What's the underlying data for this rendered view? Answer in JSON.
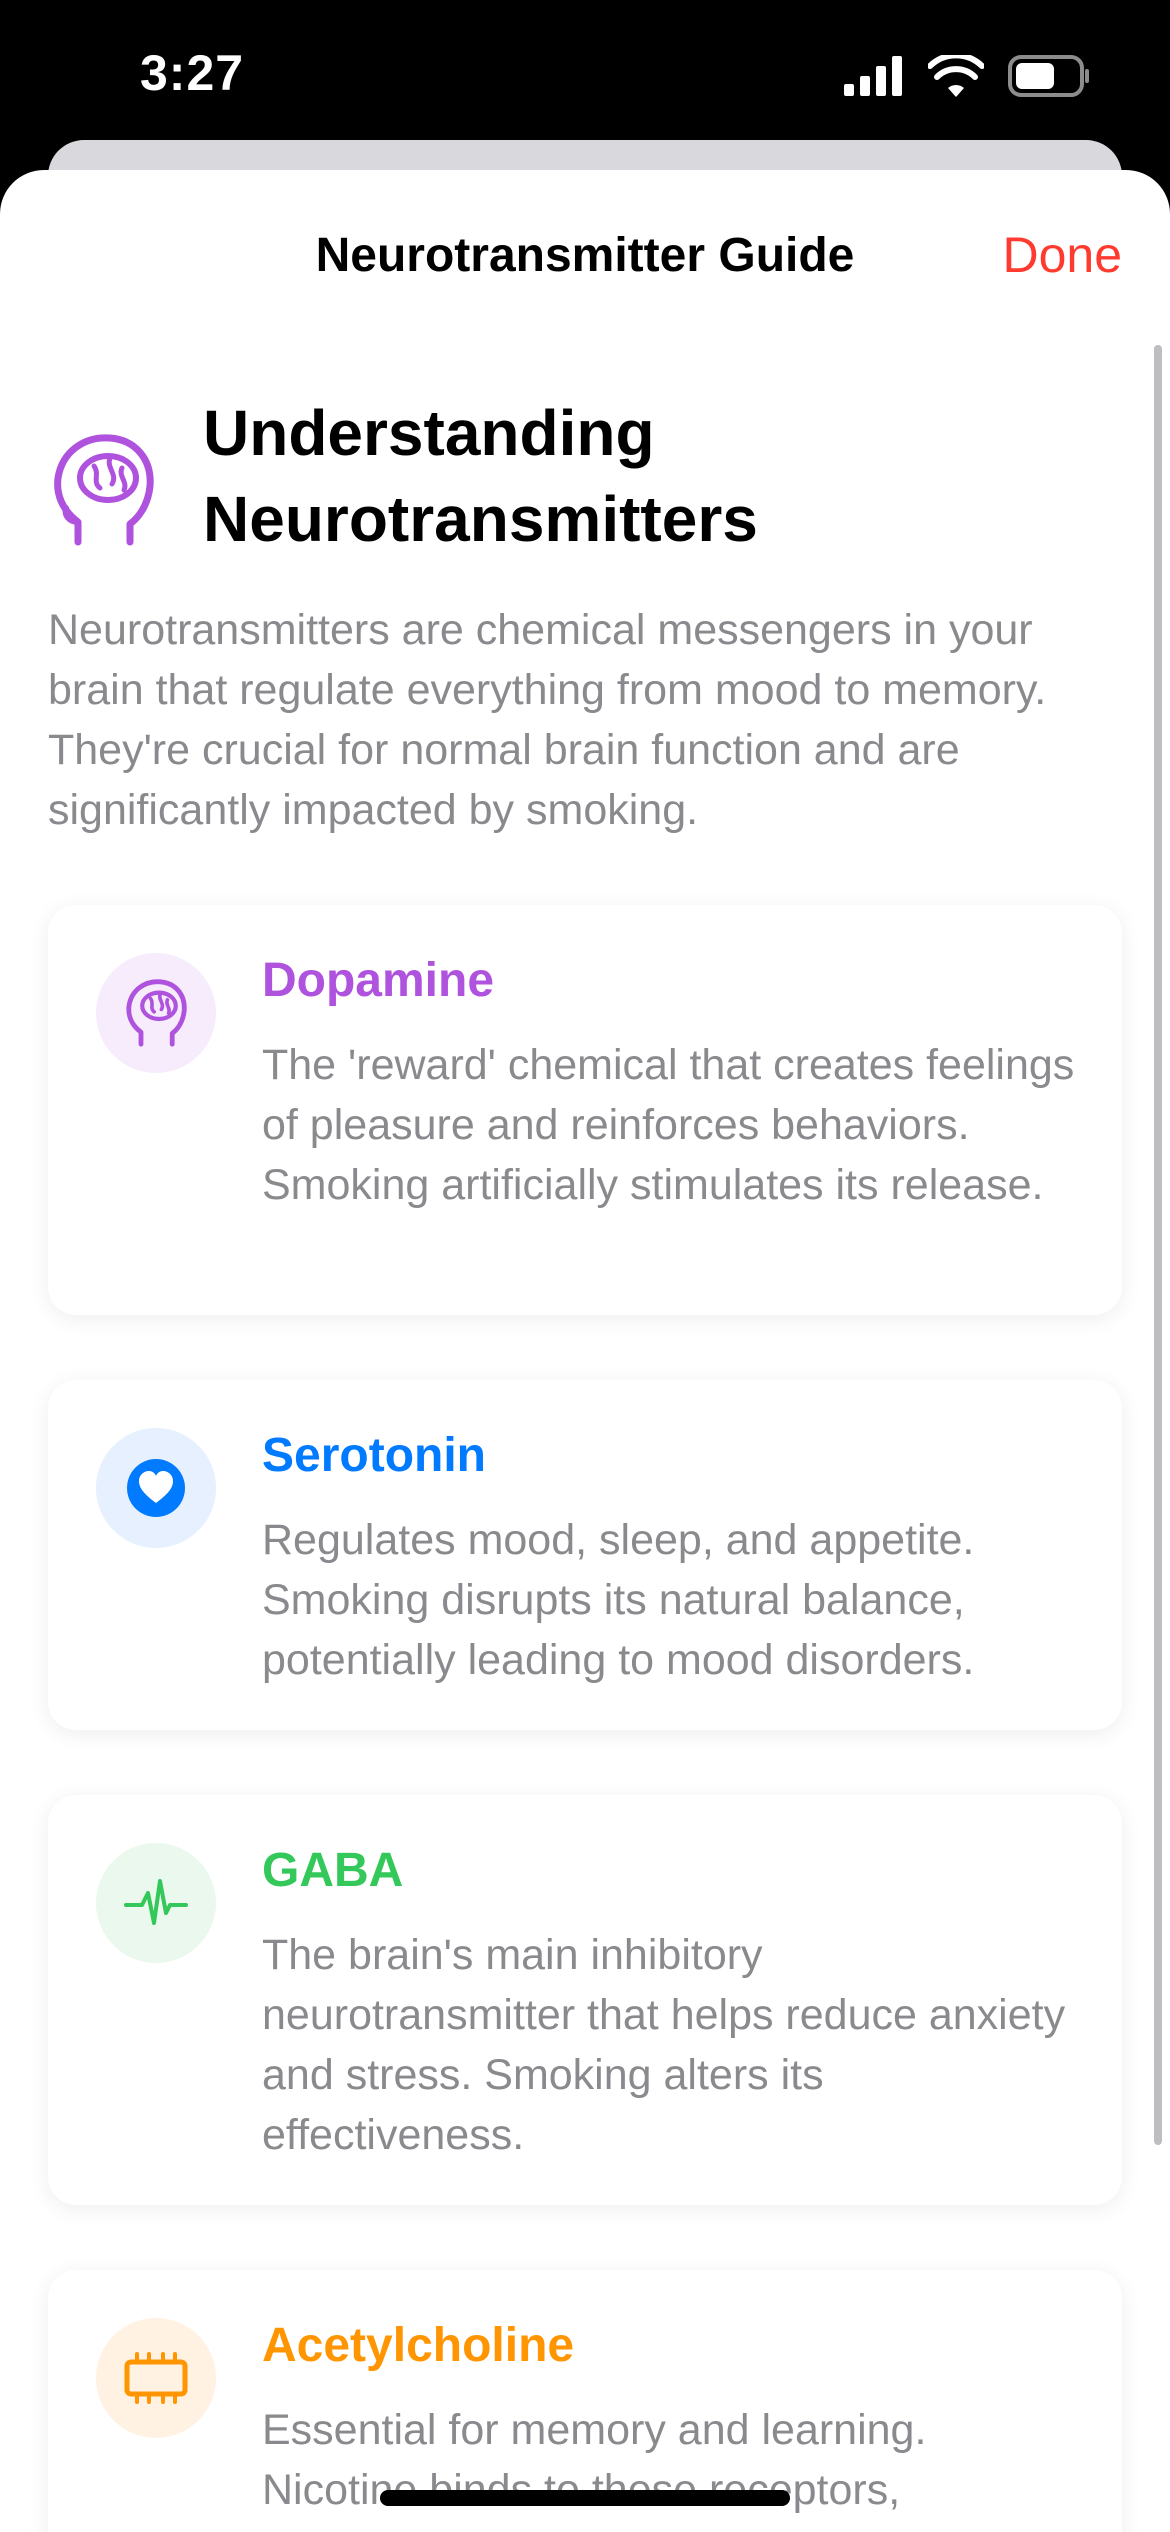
{
  "status": {
    "time": "3:27"
  },
  "nav": {
    "title": "Neurotransmitter Guide",
    "done_label": "Done"
  },
  "header": {
    "title_line1": "Understanding",
    "title_line2": "Neurotransmitters"
  },
  "intro": "Neurotransmitters are chemical messengers in your brain that regulate everything from mood to memory. They're crucial for normal brain function and are significantly impacted by smoking.",
  "cards": [
    {
      "title": "Dopamine",
      "desc": "The 'reward' chemical that creates feelings of pleasure and reinforces behaviors. Smoking artificially stimulates its release.",
      "icon": "brain-head-icon",
      "color": "#af52de",
      "bg": "#f6ecfb"
    },
    {
      "title": "Serotonin",
      "desc": "Regulates mood, sleep, and appetite. Smoking disrupts its natural balance, potentially leading to mood disorders.",
      "icon": "heart-circle-icon",
      "color": "#007aff",
      "bg": "#e6f0fe"
    },
    {
      "title": "GABA",
      "desc": "The brain's main inhibitory neurotransmitter that helps reduce anxiety and stress. Smoking alters its effectiveness.",
      "icon": "waveform-icon",
      "color": "#34c759",
      "bg": "#eaf8ee"
    },
    {
      "title": "Acetylcholine",
      "desc": "Essential for memory and learning. Nicotine binds to these receptors,",
      "icon": "memory-chip-icon",
      "color": "#ff9500",
      "bg": "#fff2e3"
    }
  ]
}
